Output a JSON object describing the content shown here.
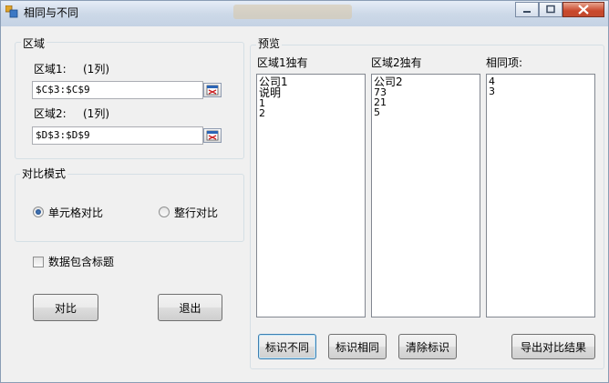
{
  "window": {
    "title": "相同与不同"
  },
  "range_group": {
    "title": "区域",
    "range1": {
      "label": "区域1:",
      "cols": "(1列)",
      "value": "$C$3:$C$9"
    },
    "range2": {
      "label": "区域2:",
      "cols": "(1列)",
      "value": "$D$3:$D$9"
    }
  },
  "mode_group": {
    "title": "对比模式",
    "cell_label": "单元格对比",
    "row_label": "整行对比",
    "selected": "cell"
  },
  "header_checkbox": {
    "label": "数据包含标题",
    "checked": false
  },
  "buttons": {
    "compare": "对比",
    "exit": "退出",
    "mark_diff": "标识不同",
    "mark_same": "标识相同",
    "clear_marks": "清除标识",
    "export": "导出对比结果"
  },
  "preview": {
    "title": "预览",
    "col1": {
      "header": "区域1独有",
      "items": [
        "公司1",
        "说明",
        "1",
        "2"
      ]
    },
    "col2": {
      "header": "区域2独有",
      "items": [
        "公司2",
        "73",
        "21",
        "5"
      ]
    },
    "col3": {
      "header": "相同项:",
      "items": [
        "4",
        "3"
      ]
    }
  },
  "colors": {
    "accent": "#3c7fb1",
    "close_button": "#c9482b"
  }
}
